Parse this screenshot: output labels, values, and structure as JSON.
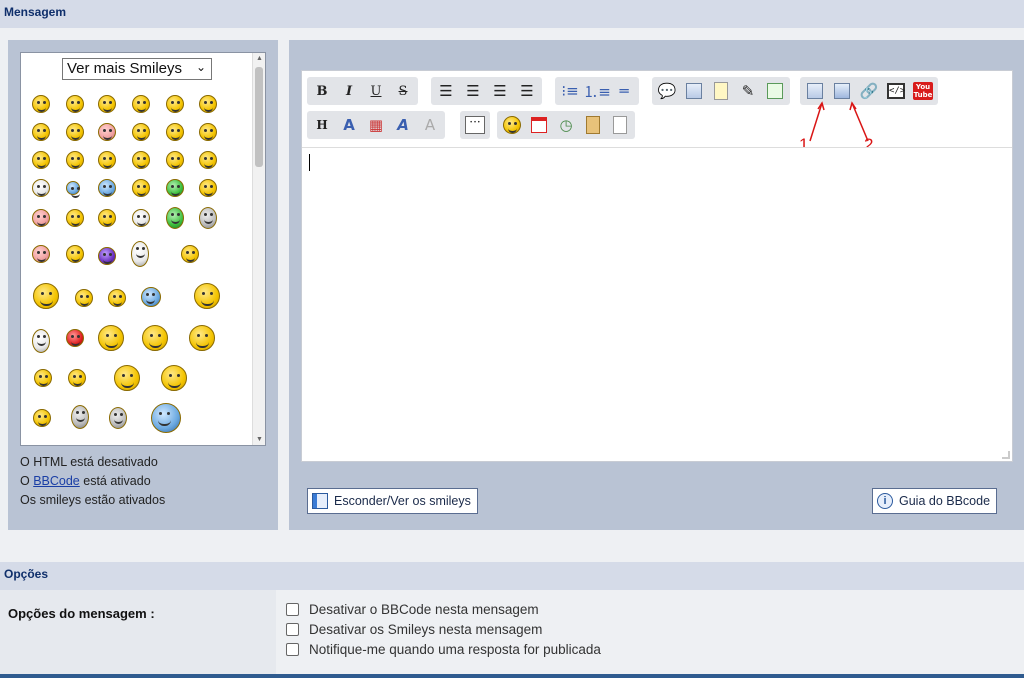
{
  "headers": {
    "message": "Mensagem",
    "options": "Opções"
  },
  "smileys": {
    "dropdown_selected": "Ver mais Smileys",
    "count_visible": 56
  },
  "status": {
    "html_prefix": "O HTML está desativado",
    "bbcode_prefix": "O ",
    "bbcode_link": "BBCode",
    "bbcode_suffix": " está ativado",
    "smileys_line": "Os smileys estão ativados"
  },
  "toolbar": {
    "row1": [
      "B",
      "I",
      "U",
      "S",
      "align-left",
      "align-center",
      "align-right",
      "justify",
      "bullet-list",
      "numbered-list",
      "horizontal-rule",
      "quote",
      "code-block",
      "spoiler",
      "hide",
      "table",
      "image-upload",
      "image",
      "link",
      "html-code",
      "youtube"
    ],
    "row2": [
      "H",
      "font-size",
      "color",
      "font",
      "remove-format",
      "more",
      "smiley",
      "date",
      "timer",
      "paste",
      "new-page"
    ]
  },
  "annotations": {
    "one": "1",
    "two": "2"
  },
  "buttons": {
    "toggle_smileys": "Esconder/Ver os smileys",
    "bbcode_guide": "Guia do BBcode"
  },
  "options": {
    "label": "Opções do mensagem :",
    "items": [
      "Desativar o BBCode nesta mensagem",
      "Desativar os Smileys nesta mensagem",
      "Notifique-me quando uma resposta for publicada"
    ]
  },
  "colors": {
    "header_bg": "#d5dbe8",
    "panel_bg": "#b9c3d4",
    "annotation": "#d91515"
  }
}
